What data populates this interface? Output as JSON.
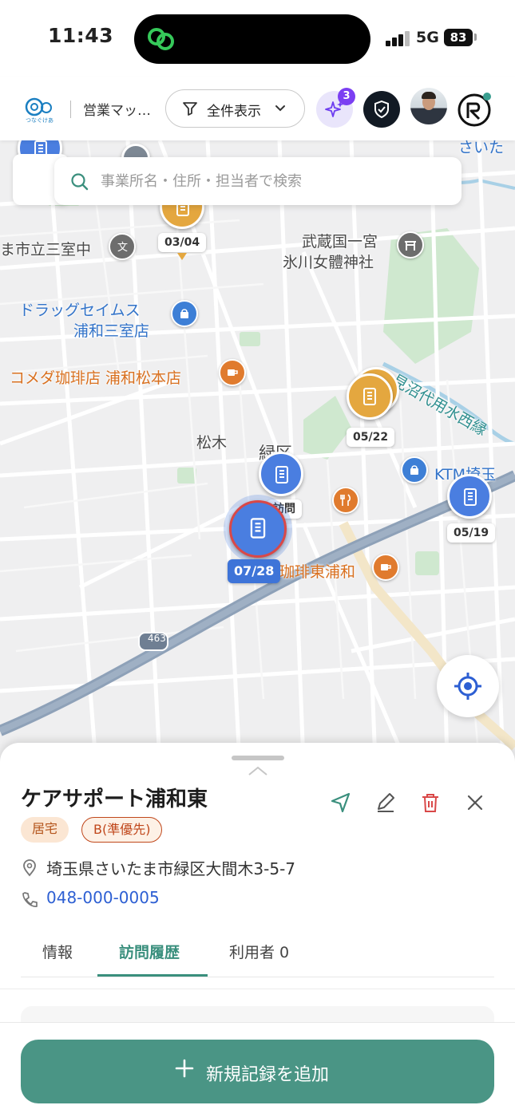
{
  "status_bar": {
    "time": "11:43",
    "network": "5G",
    "battery": "83"
  },
  "header": {
    "brand_sub": "つなぐけあ",
    "title": "営業マッ…",
    "filter_label": "全件表示",
    "ai_badge_count": "3",
    "icons": [
      "filter-icon",
      "sparkle-icon",
      "shield-icon",
      "avatar",
      "r-logo"
    ]
  },
  "search": {
    "placeholder": "事業所名・住所・担当者で検索"
  },
  "map": {
    "labels": {
      "school": "ま市立三室中",
      "shrine_line1": "武蔵国一宮",
      "shrine_line2": "氷川女體神社",
      "drug_line1": "ドラッグセイムス",
      "drug_line2": "浦和三室店",
      "komeda": "コメダ珈琲店 浦和松本店",
      "matsuki": "松木",
      "midori": "緑区",
      "canal": "見沼代用水西縁",
      "ktm": "KTM埼玉",
      "komeda2": "珈琲東浦和",
      "saita": "さいた",
      "houmon": "訪問",
      "route": "463"
    },
    "pins": [
      {
        "date": "03/04",
        "color": "orange"
      },
      {
        "date": "05/22",
        "color": "orange"
      },
      {
        "date": "05/19",
        "color": "blue"
      },
      {
        "date": "07/28",
        "color": "blue",
        "selected": true
      }
    ]
  },
  "sheet": {
    "title": "ケアサポート浦和東",
    "tags": [
      "居宅",
      "B(準優先)"
    ],
    "address": "埼玉県さいたま市緑区大間木3-5-7",
    "phone": "048-000-0005",
    "tabs": [
      "情報",
      "訪問履歴",
      "利用者 0"
    ],
    "active_tab": "訪問履歴",
    "add_button": "新規記録を追加"
  }
}
